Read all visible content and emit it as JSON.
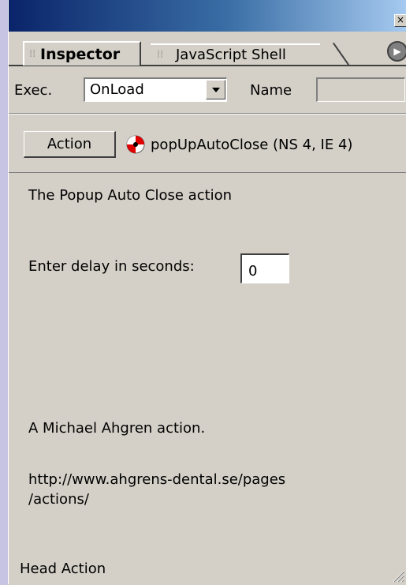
{
  "window": {
    "close_glyph": "×"
  },
  "tabs": [
    {
      "label": "Inspector",
      "active": true
    },
    {
      "label": "JavaScript Shell",
      "active": false
    }
  ],
  "exec": {
    "label": "Exec.",
    "value": "OnLoad"
  },
  "name": {
    "label": "Name",
    "value": ""
  },
  "action": {
    "button_label": "Action",
    "icon": "action-behavior-icon",
    "title": "popUpAutoClose (NS 4, IE 4)"
  },
  "body": {
    "description": "The Popup Auto Close action",
    "delay_label": "Enter delay in seconds:",
    "delay_value": "0",
    "credit": "A Michael Ahgren action.",
    "url_line1": "http://www.ahgrens-dental.se/pages",
    "url_line2": "/actions/"
  },
  "footer": {
    "label": "Head Action"
  },
  "colors": {
    "titlebar_start": "#0a246a",
    "titlebar_end": "#a6caf0",
    "panel": "#d4d0c8",
    "desktop": "#c6c3e3"
  }
}
